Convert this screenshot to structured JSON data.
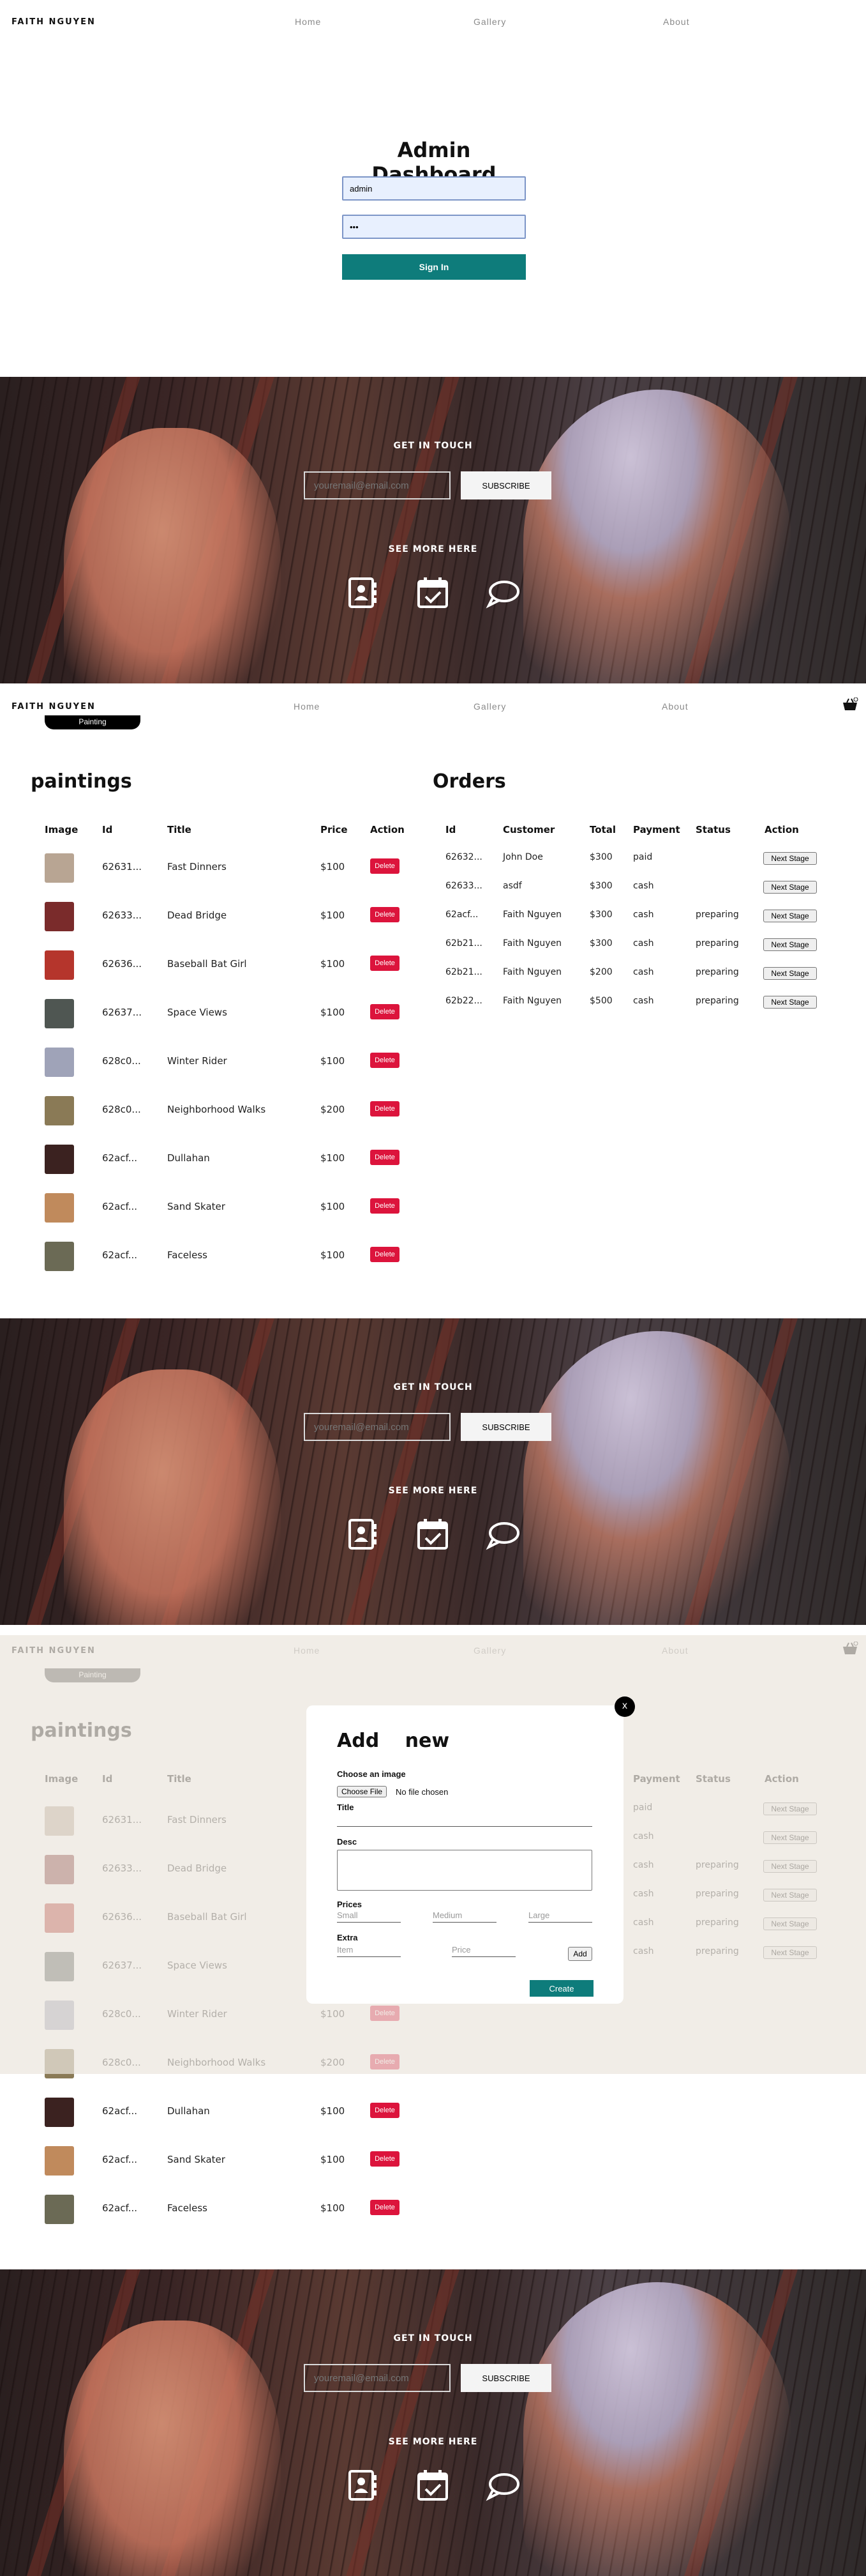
{
  "nav": {
    "brand": "FAITH NGUYEN",
    "links": [
      "Home",
      "Gallery",
      "About"
    ],
    "cart_count": "0"
  },
  "login": {
    "title": "Admin Dashboard",
    "username_value": "admin",
    "password_value": "•••",
    "sign_in_label": "Sign In"
  },
  "footer": {
    "get_in_touch": "GET IN TOUCH",
    "email_placeholder": "youremail@email.com",
    "subscribe_label": "SUBSCRIBE",
    "see_more": "SEE MORE HERE",
    "icons": [
      "contact-card-icon",
      "calendar-check-icon",
      "chat-bubble-icon"
    ]
  },
  "admin_tab_pill": "Painting",
  "paintings": {
    "title": "paintings",
    "headers": [
      "Image",
      "Id",
      "Title",
      "Price",
      "Action"
    ],
    "delete_label": "Delete",
    "rows": [
      {
        "id": "62631...",
        "title": "Fast Dinners",
        "price": "$100",
        "thumb": "#b8a593"
      },
      {
        "id": "62633...",
        "title": "Dead Bridge",
        "price": "$100",
        "thumb": "#7a2b2b"
      },
      {
        "id": "62636...",
        "title": "Baseball Bat Girl",
        "price": "$100",
        "thumb": "#b5352c"
      },
      {
        "id": "62637...",
        "title": "Space Views",
        "price": "$100",
        "thumb": "#4f5652"
      },
      {
        "id": "628c0...",
        "title": "Winter Rider",
        "price": "$100",
        "thumb": "#9fa3b8"
      },
      {
        "id": "628c0...",
        "title": "Neighborhood Walks",
        "price": "$200",
        "thumb": "#8a7a56"
      },
      {
        "id": "62acf...",
        "title": "Dullahan",
        "price": "$100",
        "thumb": "#3b2220"
      },
      {
        "id": "62acf...",
        "title": "Sand Skater",
        "price": "$100",
        "thumb": "#c08a5c"
      },
      {
        "id": "62acf...",
        "title": "Faceless",
        "price": "$100",
        "thumb": "#6b6a55"
      }
    ]
  },
  "orders": {
    "title": "Orders",
    "headers": [
      "Id",
      "Customer",
      "Total",
      "Payment",
      "Status",
      "Action"
    ],
    "next_label": "Next Stage",
    "rows": [
      {
        "id": "62632...",
        "customer": "John Doe",
        "total": "$300",
        "payment": "paid",
        "status": ""
      },
      {
        "id": "62633...",
        "customer": "asdf",
        "total": "$300",
        "payment": "cash",
        "status": ""
      },
      {
        "id": "62acf...",
        "customer": "Faith Nguyen",
        "total": "$300",
        "payment": "cash",
        "status": "preparing"
      },
      {
        "id": "62b21...",
        "customer": "Faith Nguyen",
        "total": "$300",
        "payment": "cash",
        "status": "preparing"
      },
      {
        "id": "62b21...",
        "customer": "Faith Nguyen",
        "total": "$200",
        "payment": "cash",
        "status": "preparing"
      },
      {
        "id": "62b22...",
        "customer": "Faith Nguyen",
        "total": "$500",
        "payment": "cash",
        "status": "preparing"
      }
    ]
  },
  "modal": {
    "close_label": "x",
    "title": "Add new",
    "choose_image_label": "Choose an image",
    "choose_file_btn": "Choose File",
    "no_file": "No file chosen",
    "title_label": "Title",
    "desc_label": "Desc",
    "prices_label": "Prices",
    "price_placeholders": [
      "Small",
      "Medium",
      "Large"
    ],
    "extra_label": "Extra",
    "extra_item_placeholder": "Item",
    "extra_price_placeholder": "Price",
    "add_label": "Add",
    "create_label": "Create"
  }
}
